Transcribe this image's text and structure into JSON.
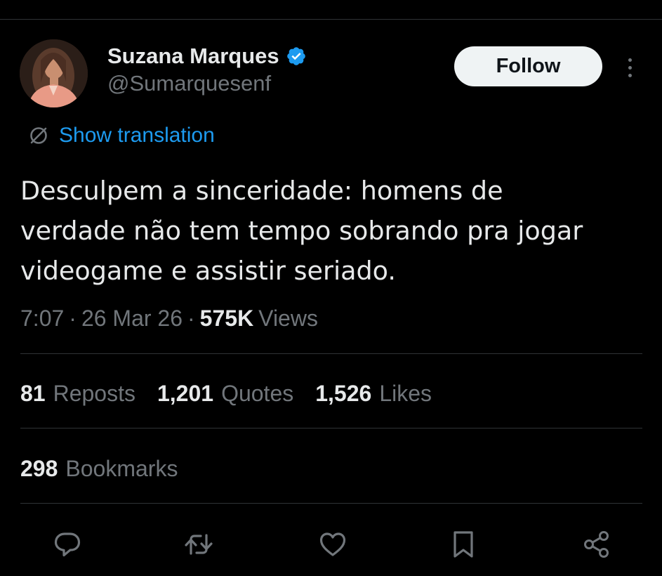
{
  "author": {
    "display_name": "Suzana Marques",
    "handle": "@Sumarquesenf",
    "verified": true
  },
  "follow_button": {
    "label": "Follow"
  },
  "translation": {
    "label": "Show translation"
  },
  "tweet": {
    "text_lines": [
      "Desculpem a sinceridade: homens de",
      "verdade não tem tempo sobrando pra jogar",
      "videogame e assistir seriado."
    ]
  },
  "meta": {
    "time": "7:07",
    "separator": "·",
    "date": "26 Mar 26",
    "views_count": "575K",
    "views_label": "Views"
  },
  "stats": {
    "reposts": {
      "count": "81",
      "label": "Reposts"
    },
    "quotes": {
      "count": "1,201",
      "label": "Quotes"
    },
    "likes": {
      "count": "1,526",
      "label": "Likes"
    },
    "bookmarks": {
      "count": "298",
      "label": "Bookmarks"
    }
  },
  "actions": [
    "reply-icon",
    "repost-icon",
    "like-icon",
    "bookmark-icon",
    "share-icon"
  ],
  "colors": {
    "background": "#000000",
    "text_primary": "#e7e9ea",
    "text_secondary": "#71767b",
    "accent": "#1d9bf0",
    "divider": "#2f3336",
    "follow_bg": "#eff3f4"
  }
}
